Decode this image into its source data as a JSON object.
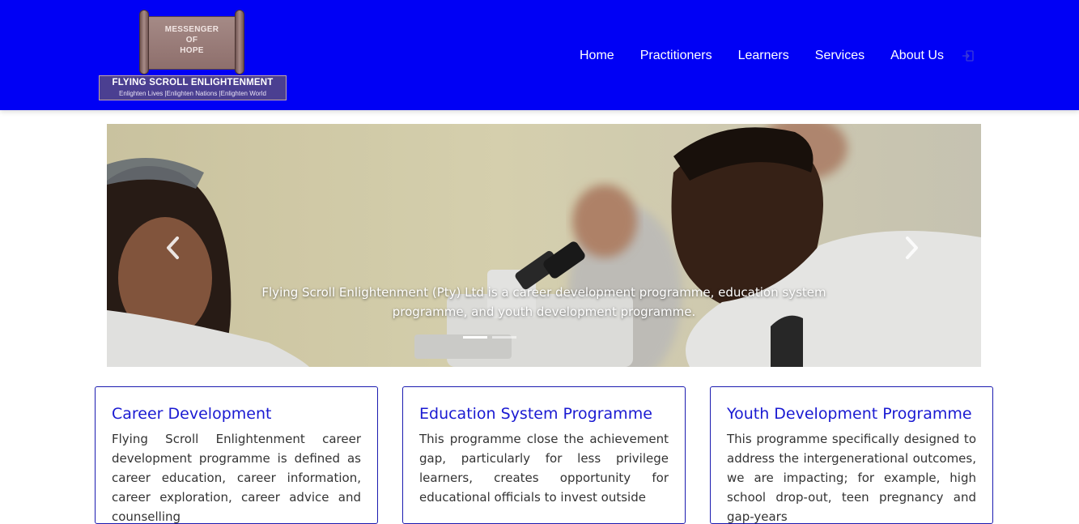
{
  "header": {
    "logo": {
      "scroll_lines": [
        "MESSENGER",
        "OF",
        "HOPE"
      ],
      "title": "FLYING SCROLL ENLIGHTENMENT",
      "tagline": "Enlighten Lives |Enlighten Nations |Enlighten World"
    },
    "nav": [
      {
        "label": "Home"
      },
      {
        "label": "Practitioners"
      },
      {
        "label": "Learners"
      },
      {
        "label": "Services"
      },
      {
        "label": "About Us"
      }
    ],
    "nav_icon": "login-icon",
    "background_color": "#0000f5"
  },
  "carousel": {
    "caption": "Flying Scroll Enlightenment (Pty) Ltd is a career development programme, education system programme, and youth development programme.",
    "prev_icon": "chevron-left-icon",
    "next_icon": "chevron-right-icon",
    "slide_count": 2,
    "active_slide": 1
  },
  "cards": [
    {
      "title": "Career Development",
      "text": "Flying Scroll Enlightenment career development programme is defined as career education, career information, career exploration, career advice and counselling"
    },
    {
      "title": "Education System Programme",
      "text": "This programme close the achievement gap, particularly for less privilege learners, creates opportunity for educational officials to invest outside"
    },
    {
      "title": "Youth Development Programme",
      "text": "This programme specifically designed to address the intergenerational outcomes, we are impacting; for example, high school drop-out, teen pregnancy and gap-years"
    }
  ],
  "colors": {
    "accent": "#1a1ad2",
    "card_border": "#1b1bb0"
  }
}
